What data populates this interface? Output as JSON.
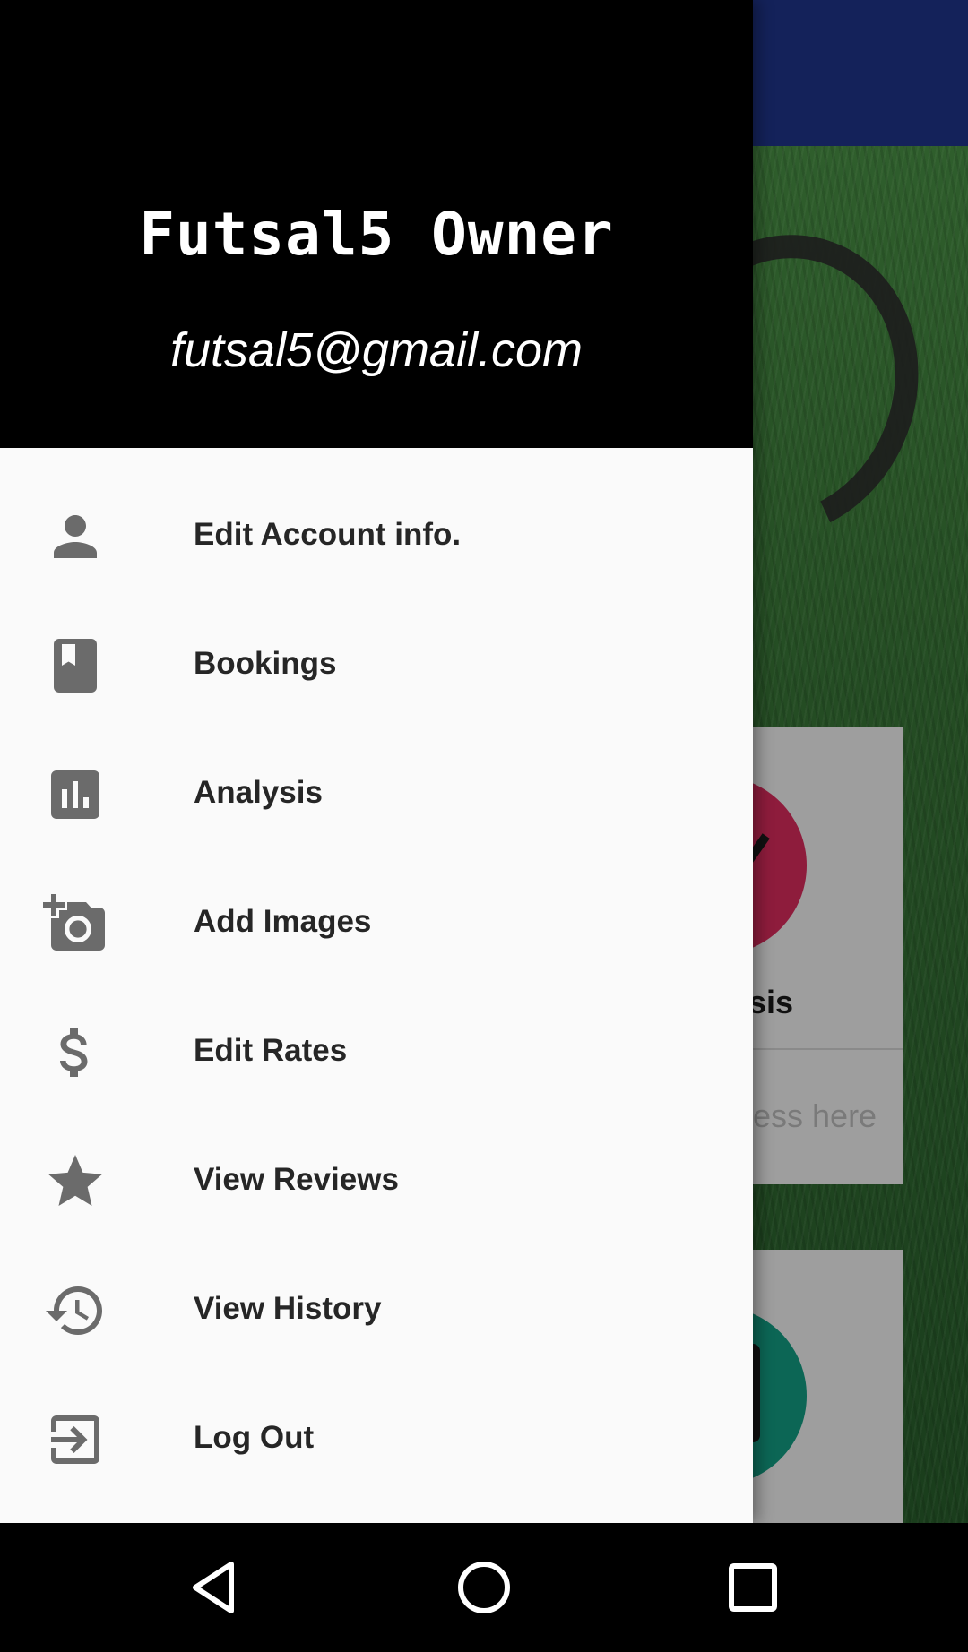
{
  "drawer": {
    "header": {
      "name": "Futsal5 Owner",
      "email": "futsal5@gmail.com"
    },
    "items": [
      {
        "label": "Edit Account info.",
        "icon": "person-icon"
      },
      {
        "label": "Bookings",
        "icon": "bookmark-book-icon"
      },
      {
        "label": "Analysis",
        "icon": "bar-chart-icon"
      },
      {
        "label": "Add Images",
        "icon": "add-camera-icon"
      },
      {
        "label": "Edit Rates",
        "icon": "dollar-icon"
      },
      {
        "label": "View Reviews",
        "icon": "star-icon"
      },
      {
        "label": "View History",
        "icon": "history-icon"
      },
      {
        "label": "Log Out",
        "icon": "logout-icon"
      }
    ]
  },
  "background": {
    "card_title_fragment": "sis",
    "card_hint_fragment": "ess here"
  },
  "colors": {
    "header_bg": "#000000",
    "drawer_bg": "#fafafa",
    "icon": "#6b6b6b",
    "toolbar": "#14225a"
  },
  "navbar": {
    "back": "back-icon",
    "home": "home-icon",
    "recents": "recents-icon"
  }
}
